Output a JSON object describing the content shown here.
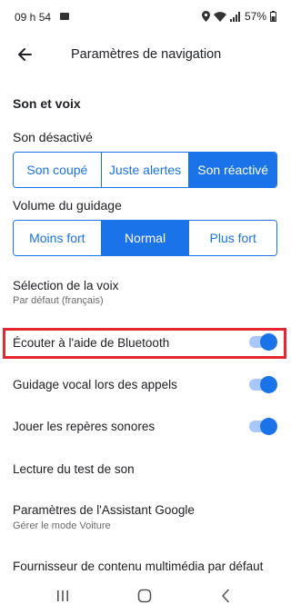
{
  "status_bar": {
    "time": "09 h 54",
    "battery": "57%",
    "icons": [
      "image-icon",
      "location-icon",
      "wifi-icon",
      "signal-icon",
      "battery-icon"
    ]
  },
  "app_bar": {
    "title": "Paramètres de navigation",
    "back_icon": "arrow-back-icon"
  },
  "section": {
    "title": "Son et voix"
  },
  "mute": {
    "label": "Son désactivé",
    "options": [
      "Son coupé",
      "Juste alertes",
      "Son réactivé"
    ],
    "selected": "Son réactivé"
  },
  "volume": {
    "label": "Volume du guidage",
    "options": [
      "Moins fort",
      "Normal",
      "Plus fort"
    ],
    "selected": "Normal"
  },
  "settings": [
    {
      "title": "Sélection de la voix",
      "subtitle": "Par défaut (français)"
    },
    {
      "title": "Écouter à l'aide de Bluetooth",
      "toggle": true
    },
    {
      "title": "Guidage vocal lors des appels",
      "toggle": true
    },
    {
      "title": "Jouer les repères sonores",
      "toggle": true
    },
    {
      "title": "Lecture du test de son"
    },
    {
      "title": "Paramètres de l'Assistant Google",
      "subtitle": "Gérer le mode Voiture"
    },
    {
      "title": "Fournisseur de contenu multimédia par défaut"
    }
  ],
  "nav_bar": {
    "icons": [
      "recents-icon",
      "home-icon",
      "back-icon"
    ]
  },
  "colors": {
    "accent": "#1a73e8",
    "toggle_track": "#a8c7fa",
    "highlight": "#e3262f"
  }
}
